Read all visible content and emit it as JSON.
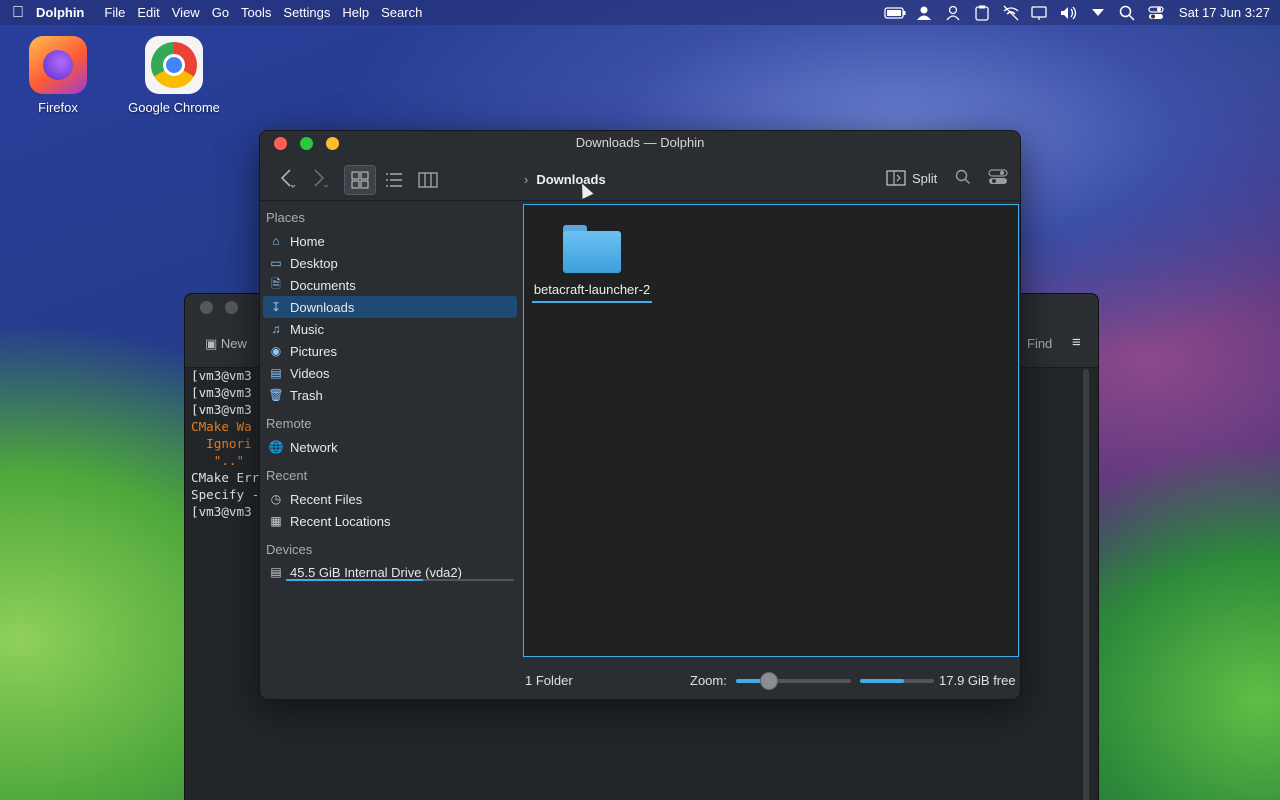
{
  "menubar": {
    "app_name": "Dolphin",
    "menus": [
      "File",
      "Edit",
      "View",
      "Go",
      "Tools",
      "Settings",
      "Help",
      "Search"
    ],
    "clock": "Sat 17 Jun 3:27"
  },
  "desktop": {
    "icons": [
      {
        "label": "Firefox"
      },
      {
        "label": "Google Chrome"
      }
    ]
  },
  "terminal": {
    "new_tab_label": "New",
    "find_label": "Find",
    "lines": [
      "[vm3@vm3",
      "[vm3@vm3",
      "[vm3@vm3",
      "CMake Wa",
      "  Ignori",
      "",
      "   \"..\"",
      "",
      "",
      "CMake Err",
      "Specify -",
      "[vm3@vm3"
    ]
  },
  "dolphin": {
    "title": "Downloads — Dolphin",
    "breadcrumb": "Downloads",
    "split_label": "Split",
    "sidebar": {
      "places_header": "Places",
      "places": [
        "Home",
        "Desktop",
        "Documents",
        "Downloads",
        "Music",
        "Pictures",
        "Videos",
        "Trash"
      ],
      "remote_header": "Remote",
      "remote": [
        "Network"
      ],
      "recent_header": "Recent",
      "recent": [
        "Recent Files",
        "Recent Locations"
      ],
      "devices_header": "Devices",
      "devices": [
        "45.5 GiB Internal Drive (vda2)"
      ],
      "drive_usage_fraction": 0.6
    },
    "content": {
      "items": [
        {
          "name": "betacraft-launcher-2"
        }
      ]
    },
    "status": {
      "count": "1 Folder",
      "zoom_label": "Zoom:",
      "free_space": "17.9 GiB free",
      "space_used_fraction": 0.6
    },
    "colors": {
      "accent": "#3daee9",
      "selection": "#1f4a74",
      "close": "#ff5f57",
      "minimize": "#febc2e",
      "maximize": "#28c840"
    }
  }
}
